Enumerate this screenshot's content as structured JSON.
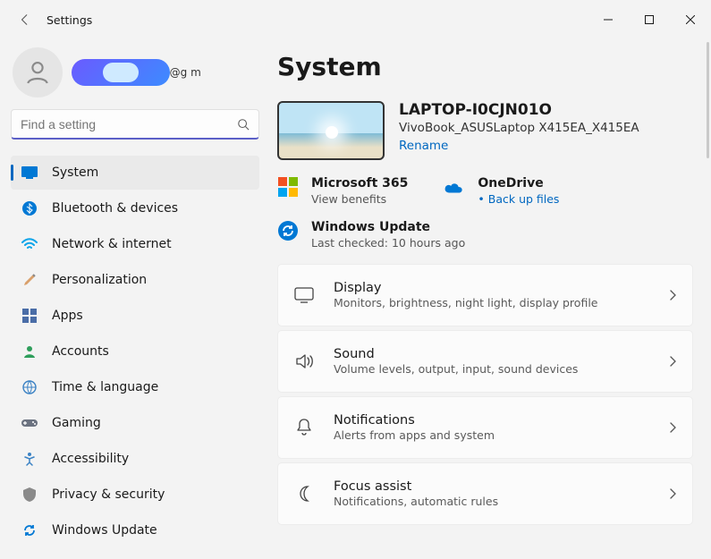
{
  "titlebar": {
    "app_title": "Settings"
  },
  "profile": {
    "email_fragment": "2@g        m"
  },
  "search": {
    "placeholder": "Find a setting"
  },
  "sidebar": {
    "items": [
      {
        "label": "System"
      },
      {
        "label": "Bluetooth & devices"
      },
      {
        "label": "Network & internet"
      },
      {
        "label": "Personalization"
      },
      {
        "label": "Apps"
      },
      {
        "label": "Accounts"
      },
      {
        "label": "Time & language"
      },
      {
        "label": "Gaming"
      },
      {
        "label": "Accessibility"
      },
      {
        "label": "Privacy & security"
      },
      {
        "label": "Windows Update"
      }
    ]
  },
  "main": {
    "title": "System",
    "device": {
      "name": "LAPTOP-I0CJN01O",
      "model": "VivoBook_ASUSLaptop X415EA_X415EA",
      "rename": "Rename"
    },
    "status": {
      "ms365": {
        "title": "Microsoft 365",
        "sub": "View benefits"
      },
      "onedrive": {
        "title": "OneDrive",
        "sub": "Back up files"
      },
      "winupdate": {
        "title": "Windows Update",
        "sub": "Last checked: 10 hours ago"
      }
    },
    "cards": [
      {
        "title": "Display",
        "sub": "Monitors, brightness, night light, display profile"
      },
      {
        "title": "Sound",
        "sub": "Volume levels, output, input, sound devices"
      },
      {
        "title": "Notifications",
        "sub": "Alerts from apps and system"
      },
      {
        "title": "Focus assist",
        "sub": "Notifications, automatic rules"
      }
    ]
  }
}
